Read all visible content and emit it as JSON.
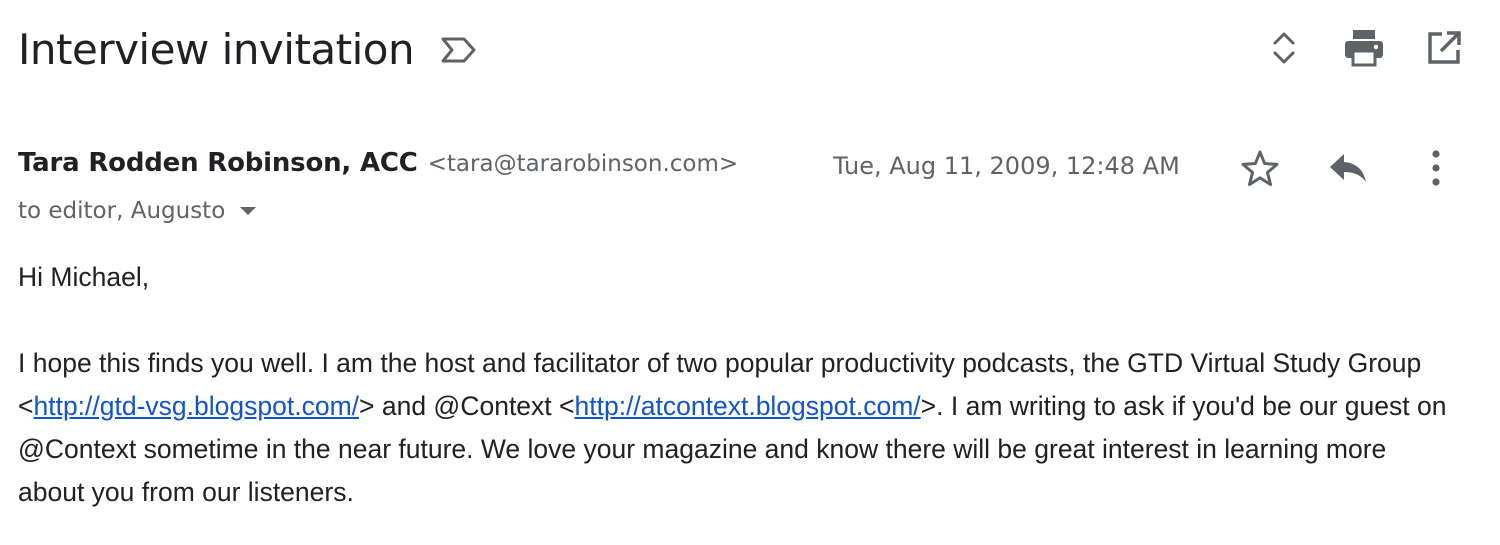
{
  "email": {
    "subject": "Interview invitation",
    "sender": {
      "name": "Tara Rodden Robinson, ACC",
      "email": "<tara@tararobinson.com>"
    },
    "date": "Tue, Aug 11, 2009, 12:48 AM",
    "recipients": "to editor, Augusto",
    "body": {
      "greeting": "Hi Michael,",
      "p1_a": "I hope this finds you well. I am the host and facilitator of two popular productivity podcasts, the GTD Virtual Study Group <",
      "link1": "http://gtd-vsg.blogspot.com/",
      "p1_b": "> and @Context <",
      "link2": "http://atcontext.blogspot.com/",
      "p1_c": ">. I am writing to ask if you'd be our guest on @Context sometime in the near future. We love your magazine and know there will be great interest in learning more about you from our listeners."
    }
  },
  "icons": {
    "importance": "label-important-outline-icon",
    "expand_collapse": "unfold-more-icon",
    "print": "print-icon",
    "open_new_window": "open-in-new-icon",
    "star": "star-outline-icon",
    "reply": "reply-icon",
    "more": "more-vert-icon",
    "recipients_caret": "caret-down-icon"
  },
  "colors": {
    "text_primary": "#202124",
    "text_secondary": "#5f6368",
    "link": "#1155cc"
  }
}
